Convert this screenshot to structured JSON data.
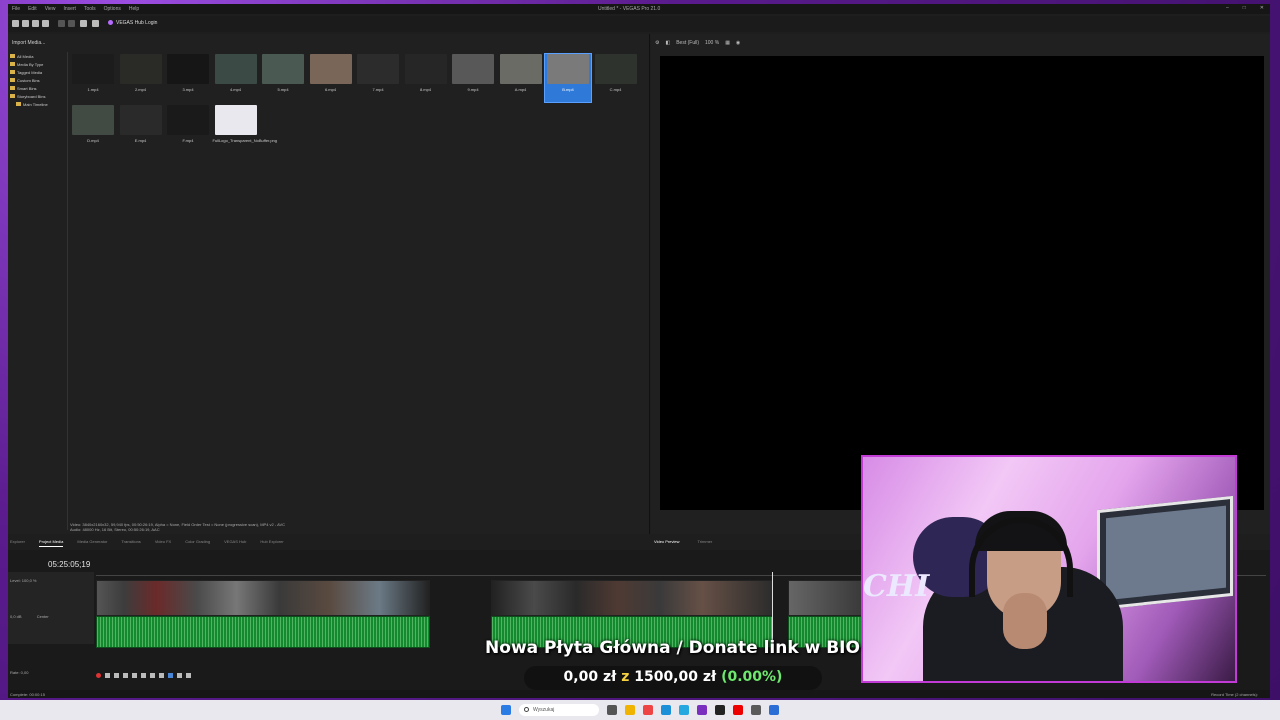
{
  "window": {
    "title": "Untitled * - VEGAS Pro 21.0",
    "menu": [
      "File",
      "Edit",
      "View",
      "Insert",
      "Tools",
      "Options",
      "Help"
    ]
  },
  "toolbar": {
    "hub_login": "VEGAS Hub Login"
  },
  "media": {
    "import_label": "Import Media...",
    "tree": [
      "All Media",
      "Media By Type",
      "Tagged Media",
      "Custom Bins",
      "Smart Bins",
      "Storyboard Bins",
      "Main Timeline"
    ],
    "items": [
      {
        "name": "1.mp4",
        "color": "#1c1c1c"
      },
      {
        "name": "2.mp4",
        "color": "#2a2a26"
      },
      {
        "name": "3.mp4",
        "color": "#161616"
      },
      {
        "name": "4.mp4",
        "color": "#3c4a46"
      },
      {
        "name": "5.mp4",
        "color": "#4a5a52"
      },
      {
        "name": "6.mp4",
        "color": "#7a6658"
      },
      {
        "name": "7.mp4",
        "color": "#2c2c2c"
      },
      {
        "name": "8.mp4",
        "color": "#262626"
      },
      {
        "name": "9.mp4",
        "color": "#585858"
      },
      {
        "name": "A.mp4",
        "color": "#6b6b66"
      },
      {
        "name": "B.mp4",
        "color": "#7a7a7a"
      },
      {
        "name": "C.mp4",
        "color": "#2e332e"
      },
      {
        "name": "D.mp4",
        "color": "#424a44"
      },
      {
        "name": "E.mp4",
        "color": "#2a2a2a"
      },
      {
        "name": "F.mp4",
        "color": "#1a1a1a"
      },
      {
        "name": "FullLogo_Transparent_NoBuffer.png",
        "color": "#e8e8ee"
      }
    ],
    "selected_index": 10,
    "info_line1": "Video: 3840x2160x32, 59,940 fps, 00:50:26:19, Alpha = None, Field Order Test = None (progressive scan), MP4 v2 - AVC",
    "info_line2": "Audio: 48000 Hz, 16 Bit, Stereo, 00:50:26:19, AAC"
  },
  "preview": {
    "quality": "Best (Full)",
    "zoom": "100 %"
  },
  "tabs_left": [
    "Explorer",
    "Project Media",
    "Media Generator",
    "Transitions",
    "Video FX",
    "Color Grading",
    "VEGAS Hub",
    "Hub Explorer"
  ],
  "tabs_left_active": 1,
  "tabs_right": [
    "Video Preview",
    "Trimmer"
  ],
  "tabs_right_active": 0,
  "timeline": {
    "timecode": "05:25:05;19",
    "video_track": {
      "level": "Level: 100,0 %"
    },
    "audio_track": {
      "vol": "0,0 dB",
      "pan": "Center"
    },
    "rate": "Rate: 0,00"
  },
  "status": {
    "left": "Complete: 00:00:15",
    "right": "Record Time (2 channels): "
  },
  "taskbar": {
    "search_placeholder": "Wyszukaj"
  },
  "overlay": {
    "donate_title": "Nowa Płyta Główna / Donate link w BIO",
    "current": "0,00 zł",
    "z": "z",
    "goal": "1500,00 zł",
    "pct": "(0.00%)",
    "progress": 0.0
  },
  "webcam": {
    "shirt_text": "CHI"
  }
}
